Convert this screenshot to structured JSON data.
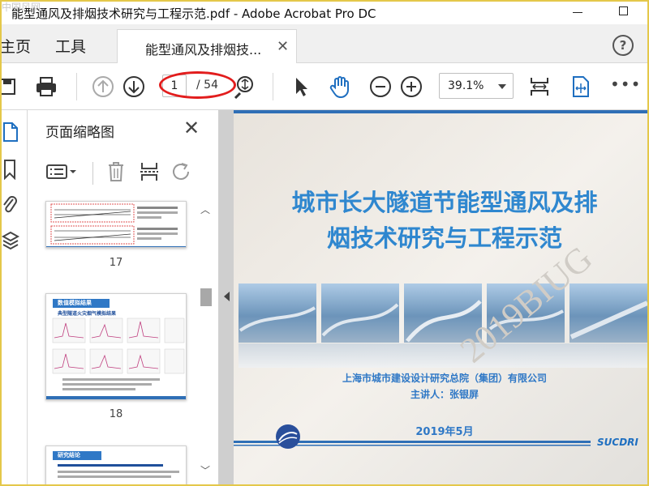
{
  "window": {
    "title": "能型通风及排烟技术研究与工程示范.pdf - Adobe Acrobat Pro DC",
    "watermark": "中国风网"
  },
  "tabs": {
    "home": "主页",
    "tools": "工具",
    "document": "能型通风及排烟技...",
    "help": "?"
  },
  "toolbar": {
    "current_page": "1",
    "total_pages": "/ 54",
    "zoom": "39.1%",
    "more": "•••",
    "icons": [
      "save-icon",
      "print-icon",
      "page-up-icon",
      "page-down-icon",
      "zoom-search-icon",
      "select-pointer-icon",
      "hand-tool-icon",
      "zoom-out-icon",
      "zoom-in-icon",
      "fit-page-icon",
      "fit-width-icon"
    ]
  },
  "thumbnail_panel": {
    "title": "页面缩略图",
    "pages": [
      {
        "number": "17"
      },
      {
        "number": "18",
        "heading": "数值模拟结果",
        "sub": "典型隧道火灾烟气模拟结果"
      },
      {
        "heading": "研究结论"
      }
    ]
  },
  "slide": {
    "title_line1": "城市长大隧道节能型通风及排",
    "title_line2": "烟技术研究与工程示范",
    "organization": "上海市城市建设设计研究总院（集团）有限公司",
    "speaker": "主讲人：张银屏",
    "date": "2019年5月",
    "brand": "SUCDRI",
    "watermark": "2019BIUG"
  },
  "colors": {
    "title_blue": "#2f87cf",
    "annotation_red": "#e21d1d",
    "frame_yellow": "#e4c84a",
    "viewer_bg": "#cfcfcf"
  }
}
